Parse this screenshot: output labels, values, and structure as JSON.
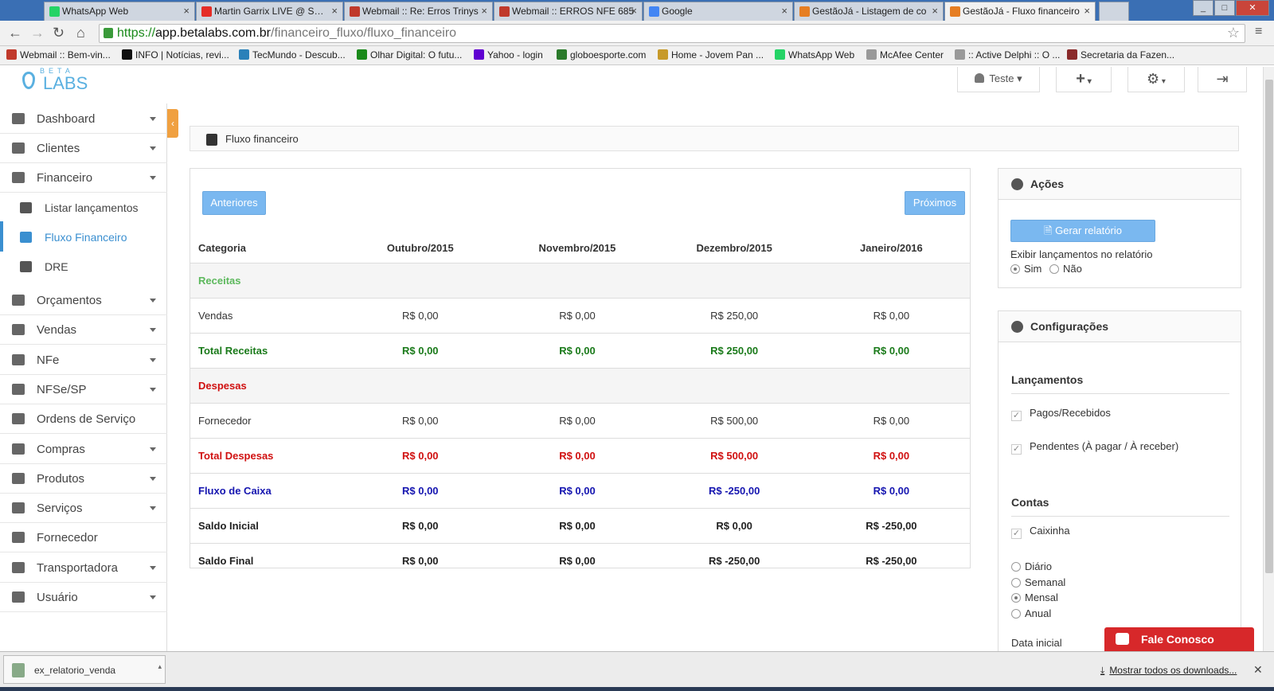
{
  "browser": {
    "tabs": [
      {
        "label": "WhatsApp Web",
        "color": "#25d366"
      },
      {
        "label": "Martin Garrix LIVE @ S…",
        "color": "#e52d27"
      },
      {
        "label": "Webmail :: Re: Erros Trinys",
        "color": "#c0392b"
      },
      {
        "label": "Webmail :: ERROS NFE 685",
        "color": "#c0392b"
      },
      {
        "label": "Google",
        "color": "#4285f4"
      },
      {
        "label": "GestãoJá - Listagem de co",
        "color": "#e67e22"
      },
      {
        "label": "GestãoJá - Fluxo financeiro",
        "color": "#e67e22",
        "active": true
      }
    ],
    "url": {
      "scheme": "https://",
      "host": "app.betalabs.com.br",
      "path": "/financeiro_fluxo/fluxo_financeiro"
    },
    "bookmarks": [
      {
        "label": "Webmail :: Bem-vin...",
        "color": "#c0392b"
      },
      {
        "label": "INFO | Notícias, revi...",
        "color": "#111"
      },
      {
        "label": "TecMundo - Descub...",
        "color": "#2980b9"
      },
      {
        "label": "Olhar Digital: O futu...",
        "color": "#1a8a1a"
      },
      {
        "label": "Yahoo - login",
        "color": "#5f01d1"
      },
      {
        "label": "globoesporte.com",
        "color": "#2a7a2a"
      },
      {
        "label": "Home - Jovem Pan ...",
        "color": "#c79a2a"
      },
      {
        "label": "WhatsApp Web",
        "color": "#25d366"
      },
      {
        "label": "McAfee Center",
        "color": "#999"
      },
      {
        "label": ":: Active Delphi :: O ...",
        "color": "#999"
      },
      {
        "label": "Secretaria da Fazen...",
        "color": "#8a2a2a"
      }
    ]
  },
  "header": {
    "logo_small": "BETA",
    "logo_big": "LABS",
    "user_label": "Teste"
  },
  "sidebar": {
    "items": [
      {
        "label": "Dashboard",
        "caret": true
      },
      {
        "label": "Clientes",
        "caret": true
      },
      {
        "label": "Financeiro",
        "caret": true
      }
    ],
    "sub_items": [
      {
        "label": "Listar lançamentos"
      },
      {
        "label": "Fluxo Financeiro",
        "active": true
      },
      {
        "label": "DRE"
      }
    ],
    "items_after": [
      {
        "label": "Orçamentos",
        "caret": true
      },
      {
        "label": "Vendas",
        "caret": true
      },
      {
        "label": "NFe",
        "caret": true
      },
      {
        "label": "NFSe/SP",
        "caret": true
      },
      {
        "label": "Ordens de Serviço",
        "caret": false
      },
      {
        "label": "Compras",
        "caret": true
      },
      {
        "label": "Produtos",
        "caret": true
      },
      {
        "label": "Serviços",
        "caret": true
      },
      {
        "label": "Fornecedor",
        "caret": false
      },
      {
        "label": "Transportadora",
        "caret": true
      },
      {
        "label": "Usuário",
        "caret": true
      }
    ]
  },
  "breadcrumb": "Fluxo financeiro",
  "main": {
    "prev_label": "Anteriores",
    "next_label": "Próximos",
    "columns": [
      "Categoria",
      "Outubro/2015",
      "Novembro/2015",
      "Dezembro/2015",
      "Janeiro/2016"
    ],
    "rows": [
      {
        "type": "section",
        "style": "gl",
        "label": "Receitas",
        "values": []
      },
      {
        "type": "row",
        "style": "",
        "label": "Vendas",
        "values": [
          "R$ 0,00",
          "R$ 0,00",
          "R$ 250,00",
          "R$ 0,00"
        ]
      },
      {
        "type": "row",
        "style": "g",
        "label": "Total Receitas",
        "values": [
          "R$ 0,00",
          "R$ 0,00",
          "R$ 250,00",
          "R$ 0,00"
        ]
      },
      {
        "type": "section",
        "style": "r",
        "label": "Despesas",
        "values": []
      },
      {
        "type": "row",
        "style": "",
        "label": "Fornecedor",
        "values": [
          "R$ 0,00",
          "R$ 0,00",
          "R$ 500,00",
          "R$ 0,00"
        ]
      },
      {
        "type": "row",
        "style": "r",
        "label": "Total Despesas",
        "values": [
          "R$ 0,00",
          "R$ 0,00",
          "R$ 500,00",
          "R$ 0,00"
        ]
      },
      {
        "type": "row",
        "style": "b",
        "label": "Fluxo de Caixa",
        "values": [
          "R$ 0,00",
          "R$ 0,00",
          "R$ -250,00",
          "R$ 0,00"
        ]
      },
      {
        "type": "row",
        "style": "k",
        "label": "Saldo Inicial",
        "values": [
          "R$ 0,00",
          "R$ 0,00",
          "R$ 0,00",
          "R$ -250,00"
        ]
      },
      {
        "type": "row",
        "style": "k",
        "label": "Saldo Final",
        "values": [
          "R$ 0,00",
          "R$ 0,00",
          "R$ -250,00",
          "R$ -250,00"
        ]
      }
    ]
  },
  "acoes": {
    "title": "Ações",
    "report_button": "Gerar relatório",
    "show_label": "Exibir lançamentos no relatório",
    "yes": "Sim",
    "no": "Não",
    "selected": "Sim"
  },
  "config": {
    "title": "Configurações",
    "lancamentos_title": "Lançamentos",
    "lancamentos": [
      {
        "label": "Pagos/Recebidos",
        "checked": true
      },
      {
        "label": "Pendentes (À pagar / À receber)",
        "checked": true
      }
    ],
    "contas_title": "Contas",
    "contas": [
      {
        "label": "Caixinha",
        "checked": true
      }
    ],
    "periodos": [
      "Diário",
      "Semanal",
      "Mensal",
      "Anual"
    ],
    "periodo_selected": "Mensal",
    "data_inicial_label": "Data inicial"
  },
  "chat": {
    "label": "Fale Conosco"
  },
  "downloads": {
    "file": "ex_relatorio_venda",
    "show_all": "Mostrar todos os downloads..."
  }
}
